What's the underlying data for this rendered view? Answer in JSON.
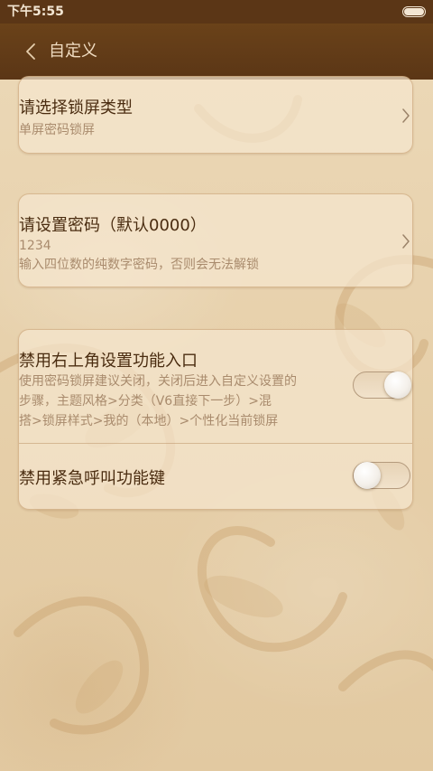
{
  "status_bar": {
    "time": "下午5:55",
    "battery_level": 1.0
  },
  "app_bar": {
    "title": "自定义",
    "back_icon": "chevron-left-icon"
  },
  "lock_type": {
    "title": "请选择锁屏类型",
    "value": "单屏密码锁屏",
    "icon": "chevron-right-icon"
  },
  "password": {
    "title": "请设置密码（默认0000）",
    "value": "1234",
    "hint": "输入四位数的纯数字密码，否则会无法解锁",
    "icon": "chevron-right-icon"
  },
  "settings": {
    "disable_corner_entry": {
      "title": "禁用右上角设置功能入口",
      "description_lines": [
        "使用密码锁屏建议关闭，关闭后进入自定义设置的",
        "步骤，主题风格>分类（V6直接下一步）>混",
        "搭>锁屏样式>我的（本地）>个性化当前锁屏"
      ],
      "toggle_on": true
    },
    "disable_emergency_call": {
      "title": "禁用紧急呼叫功能键",
      "toggle_on": false
    }
  },
  "colors": {
    "header": "#5b3616",
    "title_text": "#4a2c10",
    "sub_text": "#a98b6d",
    "background": "#e8d2ae"
  }
}
